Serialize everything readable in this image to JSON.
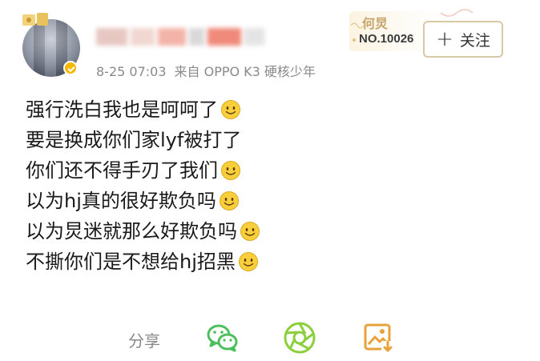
{
  "post": {
    "author": {
      "name_display": "(blurred)",
      "verified": true
    },
    "meta": {
      "time": "8-25 07:03",
      "source": "来自 OPPO K3 硬核少年"
    },
    "badge_card": {
      "name": "何炅",
      "number": "NO.10026"
    },
    "follow_button": {
      "plus": "+",
      "label": "关注"
    },
    "lines": [
      {
        "text": "强行洗白我也是呵呵了",
        "emoji": "smile"
      },
      {
        "text": "要是换成你们家lyf被打了",
        "emoji": null
      },
      {
        "text": "你们还不得手刃了我们",
        "emoji": "smile"
      },
      {
        "text": "以为hj真的很好欺负吗",
        "emoji": "smile"
      },
      {
        "text": "以为炅迷就那么好欺负吗",
        "emoji": "smile"
      },
      {
        "text": "不撕你们是不想给hj招黑",
        "emoji": "smile"
      }
    ],
    "actions": {
      "share_label": "分享",
      "icons": [
        "wechat-icon",
        "moments-icon",
        "save-image-icon"
      ]
    }
  },
  "colors": {
    "text": "#1a1a1a",
    "meta": "#8a8a8a",
    "wechat_green": "#4cbf5c",
    "moments_green": "#8ccf3c",
    "save_orange": "#e8a23a",
    "badge_gold": "#c7a56a",
    "emoji_yellow": "#f8cf3a"
  }
}
